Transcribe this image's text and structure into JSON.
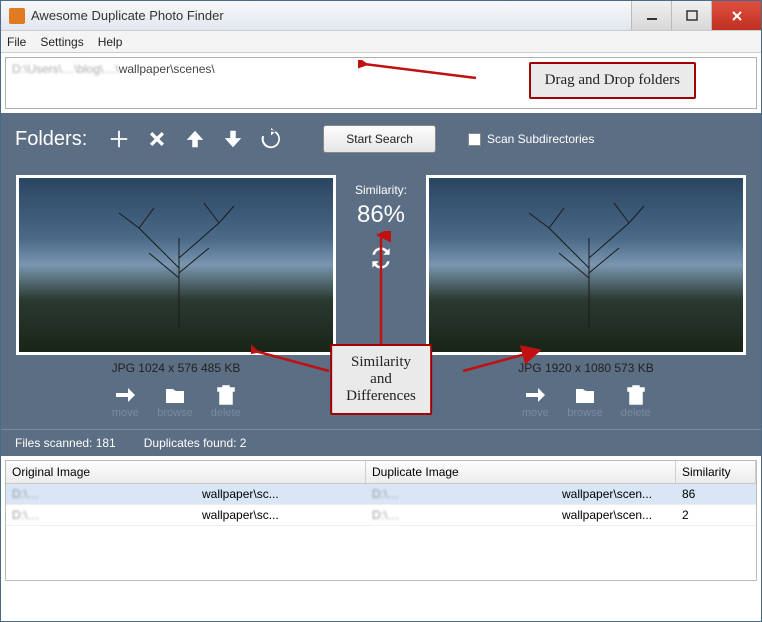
{
  "window": {
    "title": "Awesome Duplicate Photo Finder"
  },
  "menu": {
    "file": "File",
    "settings": "Settings",
    "help": "Help"
  },
  "path": {
    "prefix_blur": "D:\\Users\\…\\blog\\…\\",
    "suffix": "wallpaper\\scenes\\"
  },
  "callouts": {
    "dragdrop": "Drag and Drop folders",
    "simdiff": "Similarity\nand\nDifferences"
  },
  "toolbar": {
    "label": "Folders:",
    "start": "Start Search",
    "scan_sub": "Scan Subdirectories"
  },
  "similarity": {
    "label": "Similarity:",
    "value": "86%"
  },
  "left": {
    "info": "JPG  1024 x 576  485 KB"
  },
  "right": {
    "info": "JPG  1920 x 1080  573 KB"
  },
  "actions": {
    "move": "move",
    "browse": "browse",
    "delete": "delete"
  },
  "stats": {
    "scanned": "Files scanned: 181",
    "dupes": "Duplicates found: 2"
  },
  "table": {
    "cols": {
      "orig": "Original Image",
      "dupe": "Duplicate Image",
      "sim": "Similarity"
    },
    "rows": [
      {
        "orig_blur": "D:\\…",
        "orig_end": "wallpaper\\sc...",
        "dupe_blur": "D:\\…",
        "dupe_end": "wallpaper\\scen...",
        "sim": "86"
      },
      {
        "orig_blur": "D:\\…",
        "orig_end": "wallpaper\\sc...",
        "dupe_blur": "D:\\…",
        "dupe_end": "wallpaper\\scen...",
        "sim": "2"
      }
    ]
  }
}
